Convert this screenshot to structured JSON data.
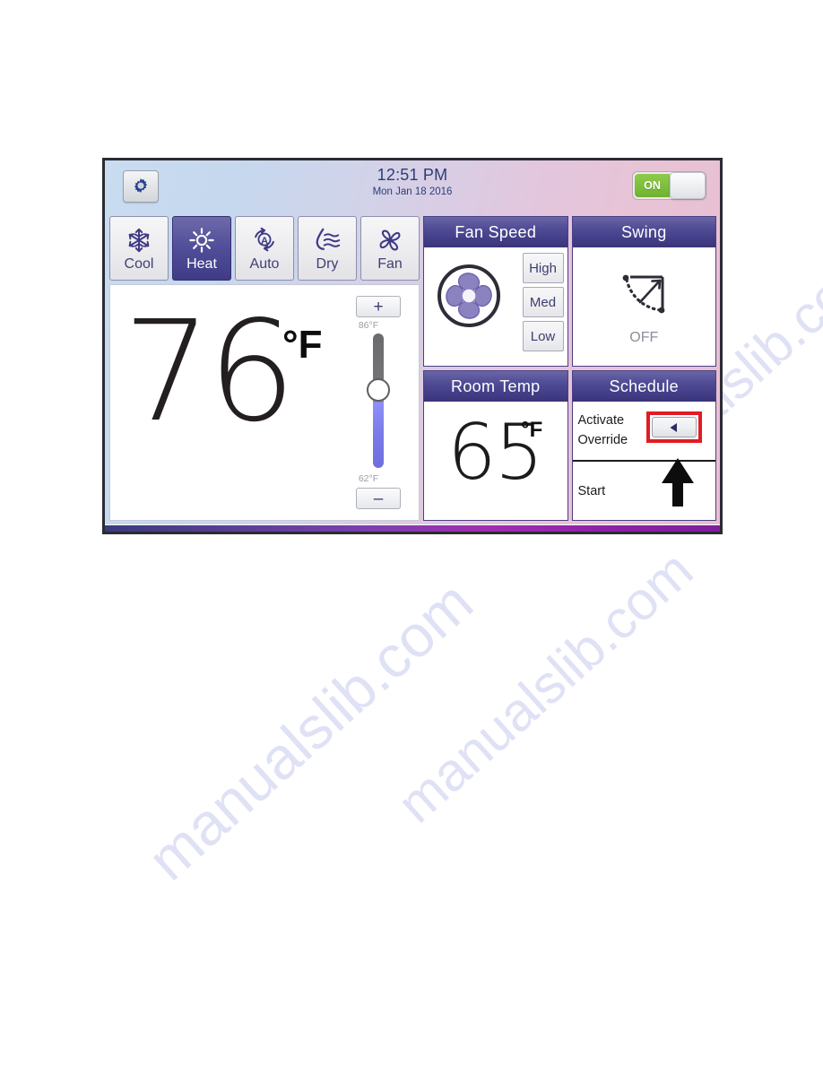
{
  "page": {
    "watermark_text": "manualslib.com"
  },
  "header": {
    "gear_icon": "gear-icon",
    "time": "12:51 PM",
    "date": "Mon Jan 18 2016",
    "power_toggle": {
      "label": "ON",
      "state": "on",
      "on_color": "#6fb22f"
    }
  },
  "modes": [
    {
      "id": "cool",
      "label": "Cool",
      "icon": "snowflake-icon",
      "active": false
    },
    {
      "id": "heat",
      "label": "Heat",
      "icon": "sun-icon",
      "active": true
    },
    {
      "id": "auto",
      "label": "Auto",
      "icon": "auto-cycle-icon",
      "active": false
    },
    {
      "id": "dry",
      "label": "Dry",
      "icon": "water-drop-waves-icon",
      "active": false
    },
    {
      "id": "fan",
      "label": "Fan",
      "icon": "fan-blades-icon",
      "active": false
    }
  ],
  "setpoint": {
    "value": "76",
    "unit": "°F",
    "plus_label": "+",
    "minus_label": "–",
    "max_tick": "86°F",
    "min_tick": "62°F",
    "slider_position_percent": 42
  },
  "fan_speed": {
    "title": "Fan Speed",
    "icon": "fan-blades-icon",
    "options": [
      {
        "label": "High",
        "selected": false
      },
      {
        "label": "Med",
        "selected": false
      },
      {
        "label": "Low",
        "selected": false
      }
    ]
  },
  "swing": {
    "title": "Swing",
    "icon": "swing-arc-arrow-icon",
    "status": "OFF"
  },
  "room_temp": {
    "title": "Room Temp",
    "value": "65",
    "unit": "°F"
  },
  "schedule": {
    "title": "Schedule",
    "override_label_line1": "Activate",
    "override_label_line2": "Override",
    "override_button_icon": "left-triangle-icon",
    "override_highlight_color": "#e21b22",
    "start_label": "Start",
    "start_annotation_icon": "up-arrow-annotation-icon"
  },
  "theme": {
    "panel_header_purple": "#443f89",
    "mode_active_purple": "#443f89",
    "icon_navy": "#3f3b86",
    "accent_red": "#e21b22",
    "slider_blue": "#7a7ae8"
  }
}
